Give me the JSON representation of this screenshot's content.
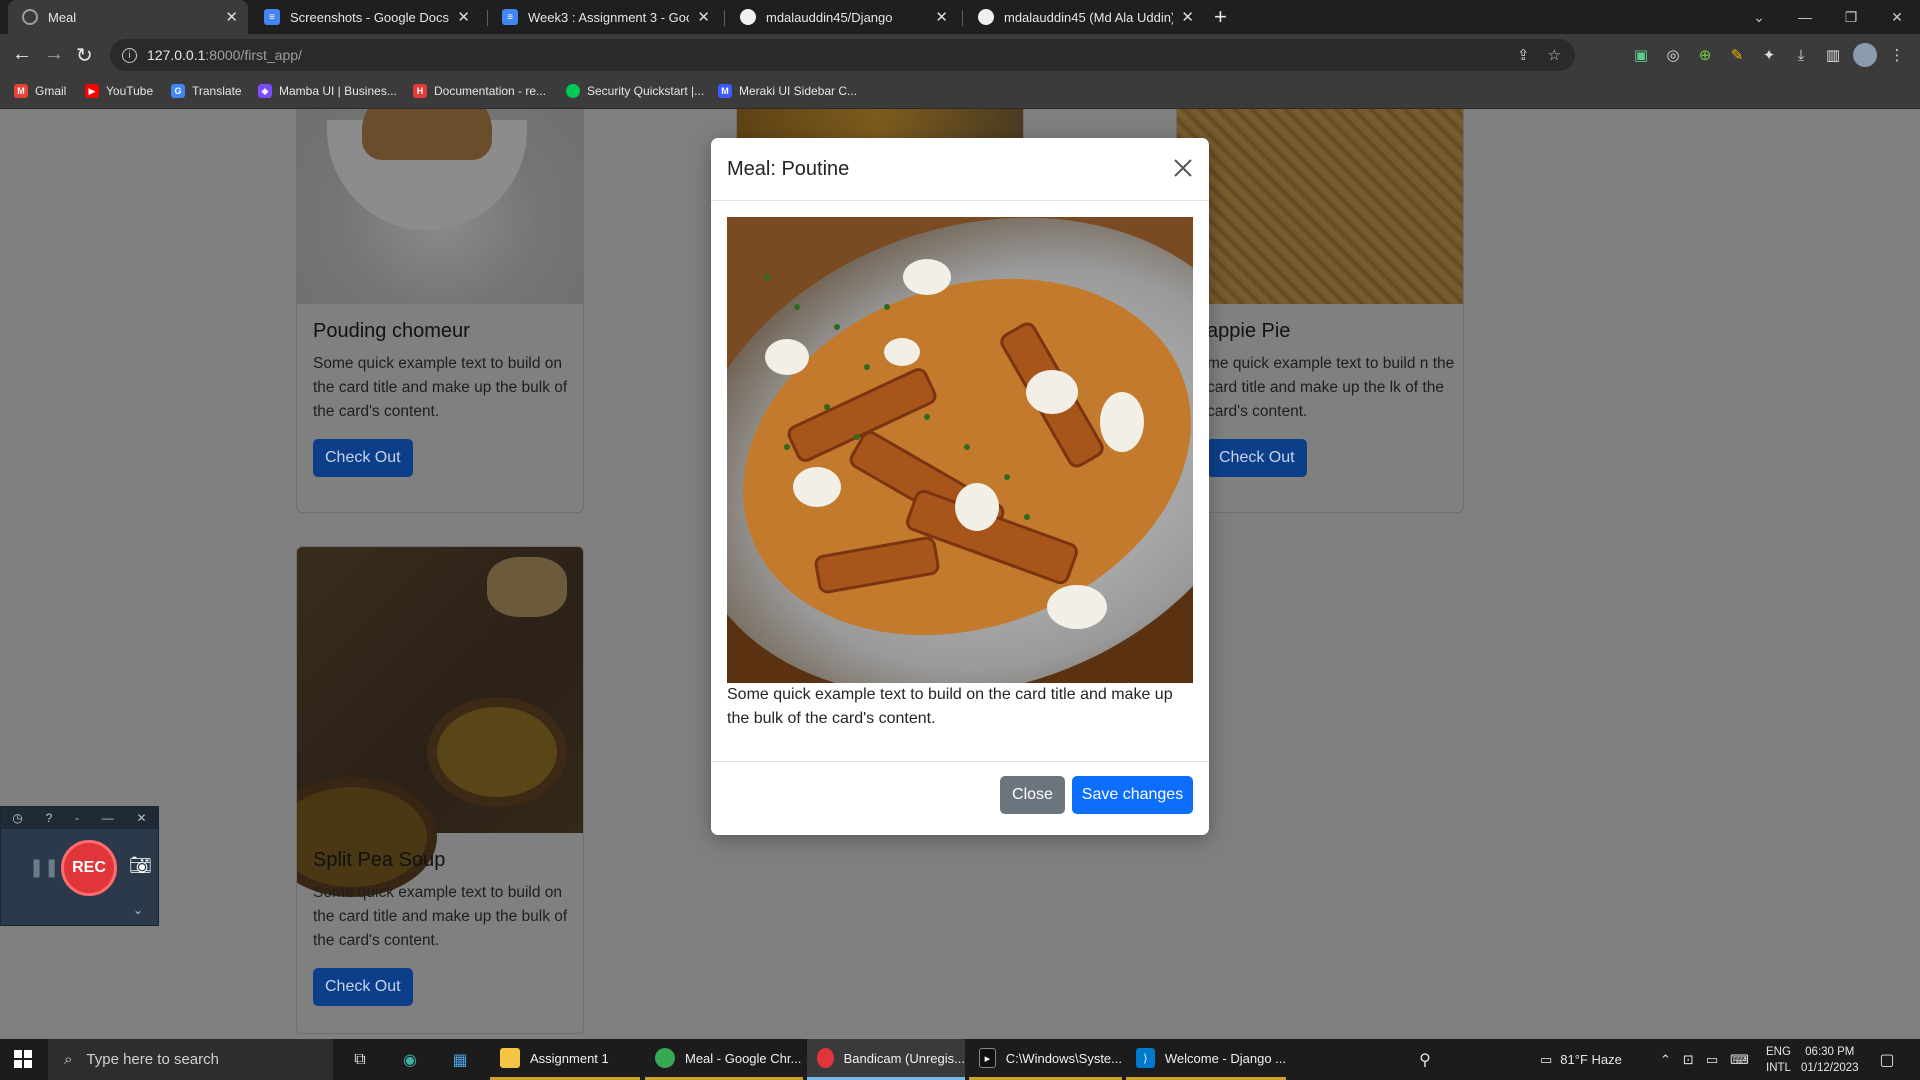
{
  "browser": {
    "tabs": [
      {
        "title": "Meal",
        "icon": "globe-icon",
        "active": true
      },
      {
        "title": "Screenshots - Google Docs",
        "icon": "docs-icon",
        "active": false
      },
      {
        "title": "Week3 : Assignment 3 - Google",
        "icon": "docs-icon",
        "active": false
      },
      {
        "title": "mdalauddin45/Django",
        "icon": "github-icon",
        "active": false
      },
      {
        "title": "mdalauddin45 (Md Ala Uddin)",
        "icon": "github-icon",
        "active": false
      }
    ],
    "url_host": "127.0.0.1",
    "url_rest": ":8000/first_app/",
    "bookmarks": [
      {
        "label": "Gmail",
        "color": "#ea4335"
      },
      {
        "label": "YouTube",
        "color": "#ff0000"
      },
      {
        "label": "Translate",
        "color": "#4285f4"
      },
      {
        "label": "Mamba UI | Busines...",
        "color": "#7c4dff"
      },
      {
        "label": "Documentation - re...",
        "color": "#e53935"
      },
      {
        "label": "Security Quickstart |...",
        "color": "#00c853"
      },
      {
        "label": "Meraki UI Sidebar C...",
        "color": "#3d5afe"
      }
    ]
  },
  "cards": [
    {
      "title": "Pouding chomeur",
      "text": "Some quick example text to build on the card title and make up the bulk of the card's content.",
      "button": "Check Out"
    },
    {
      "title": "appie Pie",
      "text": "me quick example text to build n the card title and make up the lk of the card's content.",
      "button": "Check Out"
    },
    {
      "title": "Split Pea Soup",
      "text": "Some quick example text to build on the card title and make up the bulk of the card's content.",
      "button": "Check Out"
    }
  ],
  "modal": {
    "title": "Meal: Poutine",
    "text": "Some quick example text to build on the card title and make up the bulk of the card's content.",
    "close_label": "Close",
    "save_label": "Save changes"
  },
  "bandicam": {
    "rec_label": "REC"
  },
  "taskbar": {
    "search_placeholder": "Type here to search",
    "apps": [
      {
        "label": "Assignment 1",
        "icon": "folder-icon"
      },
      {
        "label": "Meal - Google Chr...",
        "icon": "chrome-icon"
      },
      {
        "label": "Bandicam (Unregis...",
        "icon": "bandicam-icon"
      },
      {
        "label": "C:\\Windows\\Syste...",
        "icon": "terminal-icon"
      },
      {
        "label": "Welcome - Django ...",
        "icon": "vscode-icon"
      }
    ],
    "weather": "81°F  Haze",
    "lang_top": "ENG",
    "lang_bottom": "INTL",
    "time": "06:30 PM",
    "date": "01/12/2023"
  }
}
